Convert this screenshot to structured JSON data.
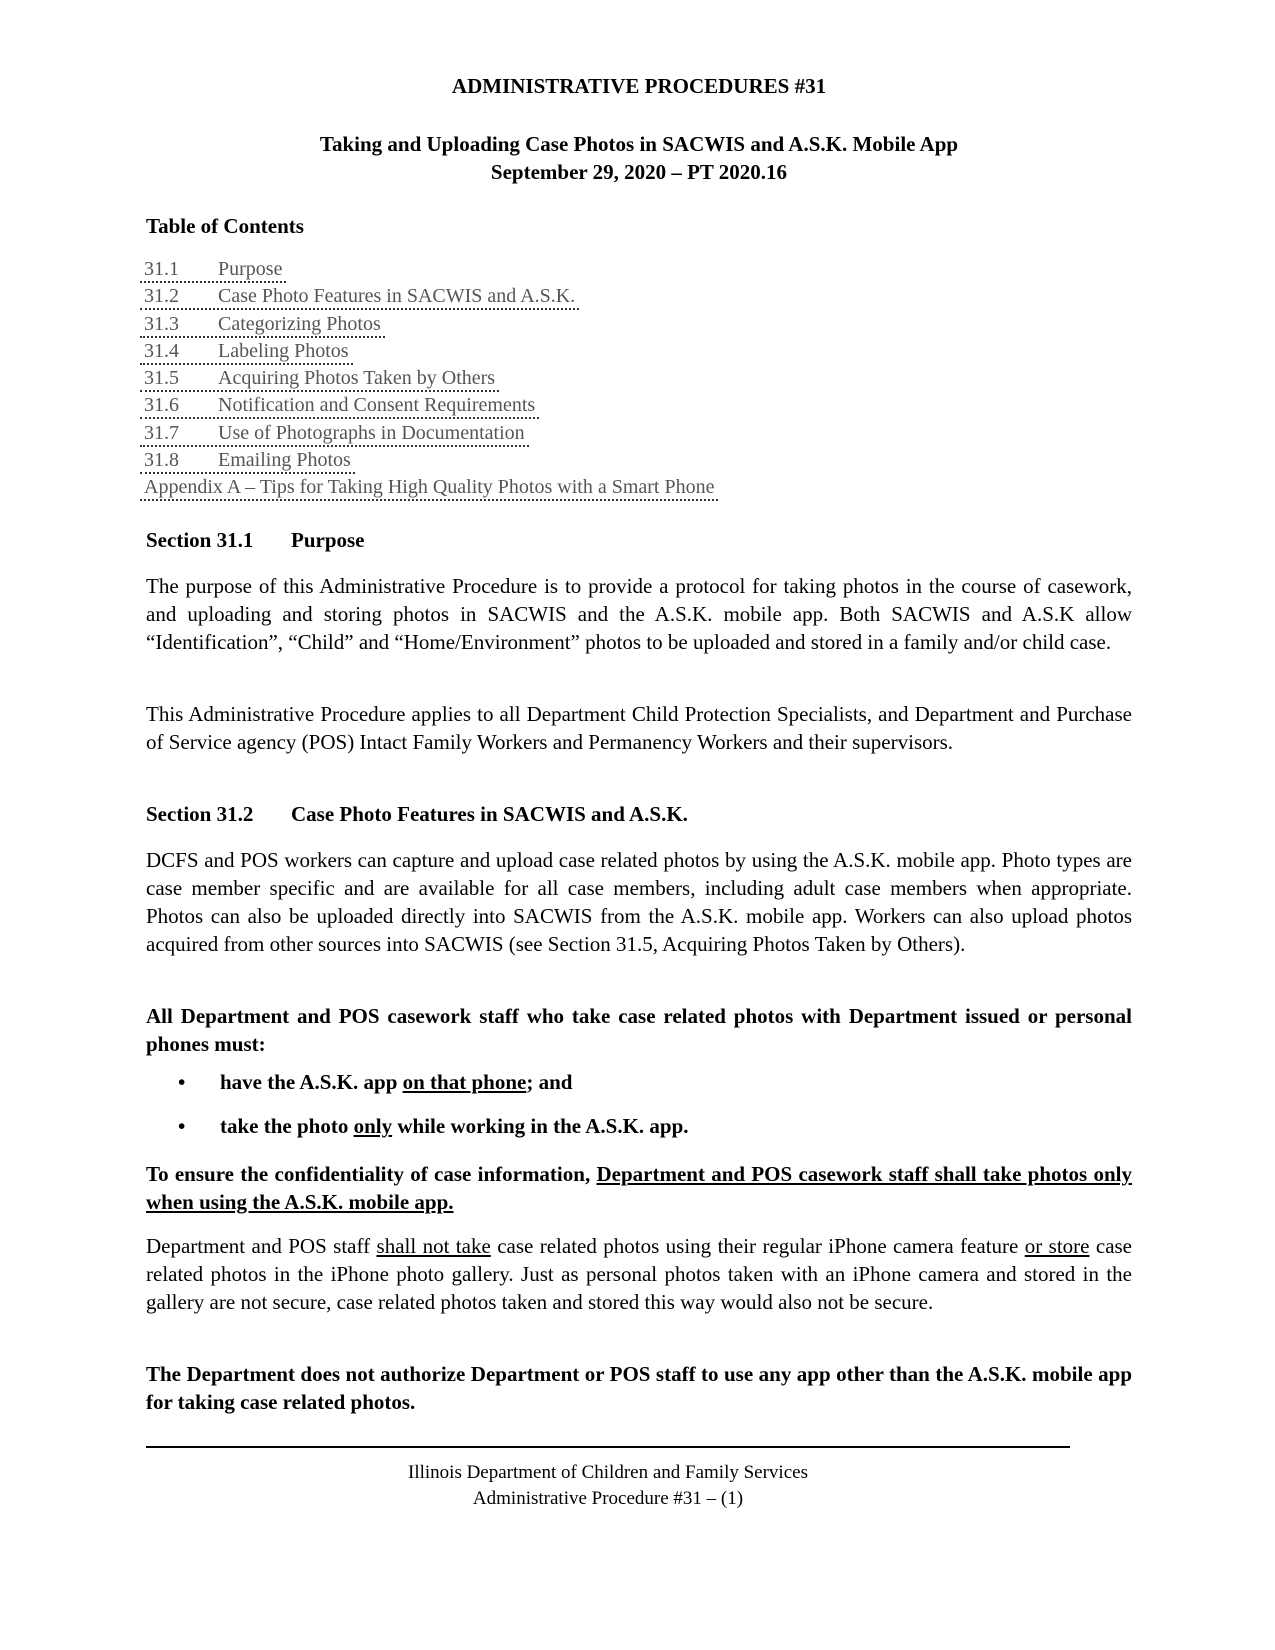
{
  "header": {
    "title": "ADMINISTRATIVE PROCEDURES #31",
    "subtitle": "Taking and Uploading Case Photos in SACWIS and A.S.K. Mobile App",
    "date_line": "September 29, 2020 – PT 2020.16"
  },
  "toc": {
    "title": "Table of Contents",
    "items": [
      {
        "num": "31.1",
        "label": "Purpose"
      },
      {
        "num": "31.2",
        "label": "Case Photo Features in SACWIS and A.S.K."
      },
      {
        "num": "31.3",
        "label": "Categorizing Photos"
      },
      {
        "num": "31.4",
        "label": "Labeling Photos"
      },
      {
        "num": "31.5",
        "label": "Acquiring Photos Taken by Others"
      },
      {
        "num": "31.6",
        "label": "Notification and Consent Requirements"
      },
      {
        "num": "31.7",
        "label": "Use of Photographs in Documentation"
      },
      {
        "num": "31.8",
        "label": "Emailing Photos"
      }
    ],
    "appendix": "Appendix A – Tips for Taking High Quality Photos with a Smart Phone"
  },
  "section_31_1": {
    "num": "Section 31.1",
    "title": "Purpose",
    "p1": "The purpose of this Administrative Procedure is to provide a protocol for taking photos in the course of casework, and uploading and storing photos in SACWIS and the A.S.K. mobile app. Both SACWIS and A.S.K allow “Identification”, “Child” and “Home/Environment” photos to be uploaded and stored in a family and/or child case.",
    "p2": "This Administrative Procedure applies to all Department Child Protection Specialists, and Department and Purchase of Service agency (POS) Intact Family Workers and Permanency Workers and their supervisors."
  },
  "section_31_2": {
    "num": "Section 31.2",
    "title": "Case Photo Features in SACWIS and A.S.K.",
    "p1": "DCFS and POS workers can capture and upload case related photos by using the A.S.K. mobile app.  Photo types are case member specific and are available for all case members, including adult case members when appropriate.  Photos can also be uploaded directly into SACWIS from the A.S.K. mobile app.  Workers can also upload photos acquired from other sources into SACWIS (see Section 31.5, Acquiring Photos Taken by Others).",
    "p2": "All Department and POS casework staff who take case related photos with Department issued or personal phones must:",
    "bullet1": {
      "pre": "have the A.S.K. app ",
      "u": "on that phone",
      "post": "; and"
    },
    "bullet2": {
      "pre": "take the photo ",
      "u": "only",
      "post": " while working in the A.S.K. app."
    },
    "p3": {
      "pre": "To ensure the confidentiality of case information, ",
      "u": "Department and POS casework staff shall take photos only when using the A.S.K. mobile app."
    },
    "p4": {
      "a": "Department and POS staff ",
      "u1": "shall not take",
      "b": " case related photos using their regular iPhone camera feature ",
      "u2": "or store",
      "c": " case related photos in the iPhone photo gallery.  Just as personal photos taken with an iPhone camera and stored in the gallery are not secure, case related photos taken and stored this way would also not be secure."
    },
    "p5": "The Department does not authorize Department or POS staff to use any app other than the A.S.K. mobile app for taking case related photos."
  },
  "footer": {
    "line1": "Illinois Department of Children and Family Services",
    "line2": "Administrative Procedure #31 – (1)"
  }
}
